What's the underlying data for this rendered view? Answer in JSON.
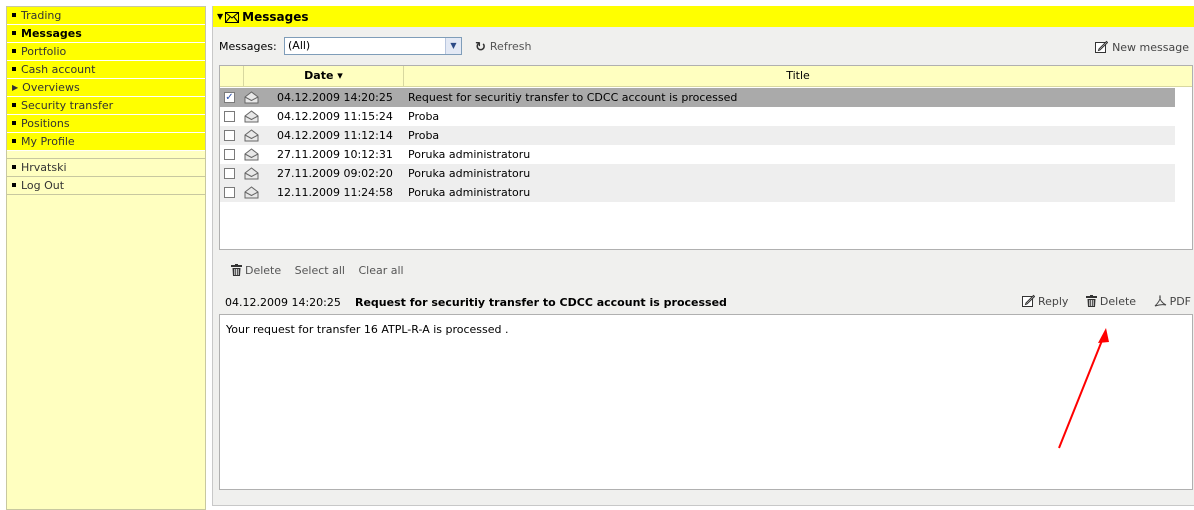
{
  "sidebar": {
    "items": [
      {
        "label": "Trading",
        "marker": "bullet"
      },
      {
        "label": "Messages",
        "marker": "bullet",
        "active": true
      },
      {
        "label": "Portfolio",
        "marker": "bullet"
      },
      {
        "label": "Cash account",
        "marker": "bullet"
      },
      {
        "label": "Overviews",
        "marker": "arrow"
      },
      {
        "label": "Security transfer",
        "marker": "bullet"
      },
      {
        "label": "Positions",
        "marker": "bullet"
      },
      {
        "label": "My Profile",
        "marker": "bullet"
      }
    ],
    "language_label": "Hrvatski",
    "logout_label": "Log Out"
  },
  "header": {
    "title": "Messages",
    "icon": "envelope-icon"
  },
  "toolbar": {
    "filter_label": "Messages:",
    "filter_value": "(All)",
    "refresh_label": "Refresh",
    "new_message_label": "New message"
  },
  "table": {
    "columns": {
      "date": "Date",
      "title": "Title"
    },
    "sort_indicator": "▾",
    "rows": [
      {
        "date": "04.12.2009 14:20:25",
        "title": "Request for securitiy transfer to CDCC account is processed",
        "checked": true,
        "selected": true
      },
      {
        "date": "04.12.2009 11:15:24",
        "title": "Proba",
        "checked": false
      },
      {
        "date": "04.12.2009 11:12:14",
        "title": "Proba",
        "checked": false
      },
      {
        "date": "27.11.2009 10:12:31",
        "title": "Poruka administratoru",
        "checked": false
      },
      {
        "date": "27.11.2009 09:02:20",
        "title": "Poruka administratoru",
        "checked": false
      },
      {
        "date": "12.11.2009 11:24:58",
        "title": "Poruka administratoru",
        "checked": false
      }
    ]
  },
  "bulk_actions": {
    "delete_label": "Delete",
    "select_all_label": "Select all",
    "clear_all_label": "Clear all"
  },
  "preview": {
    "date": "04.12.2009 14:20:25",
    "title": "Request for securitiy transfer to CDCC account is processed",
    "reply_label": "Reply",
    "delete_label": "Delete",
    "pdf_label": "PDF",
    "body": "Your request for transfer 16 ATPL-R-A is processed ."
  },
  "colors": {
    "accent_yellow": "#ffff00",
    "sidebar_bg": "#ffffc0",
    "selected_row": "#aaaaaa",
    "annotation_arrow": "#ff0000"
  }
}
